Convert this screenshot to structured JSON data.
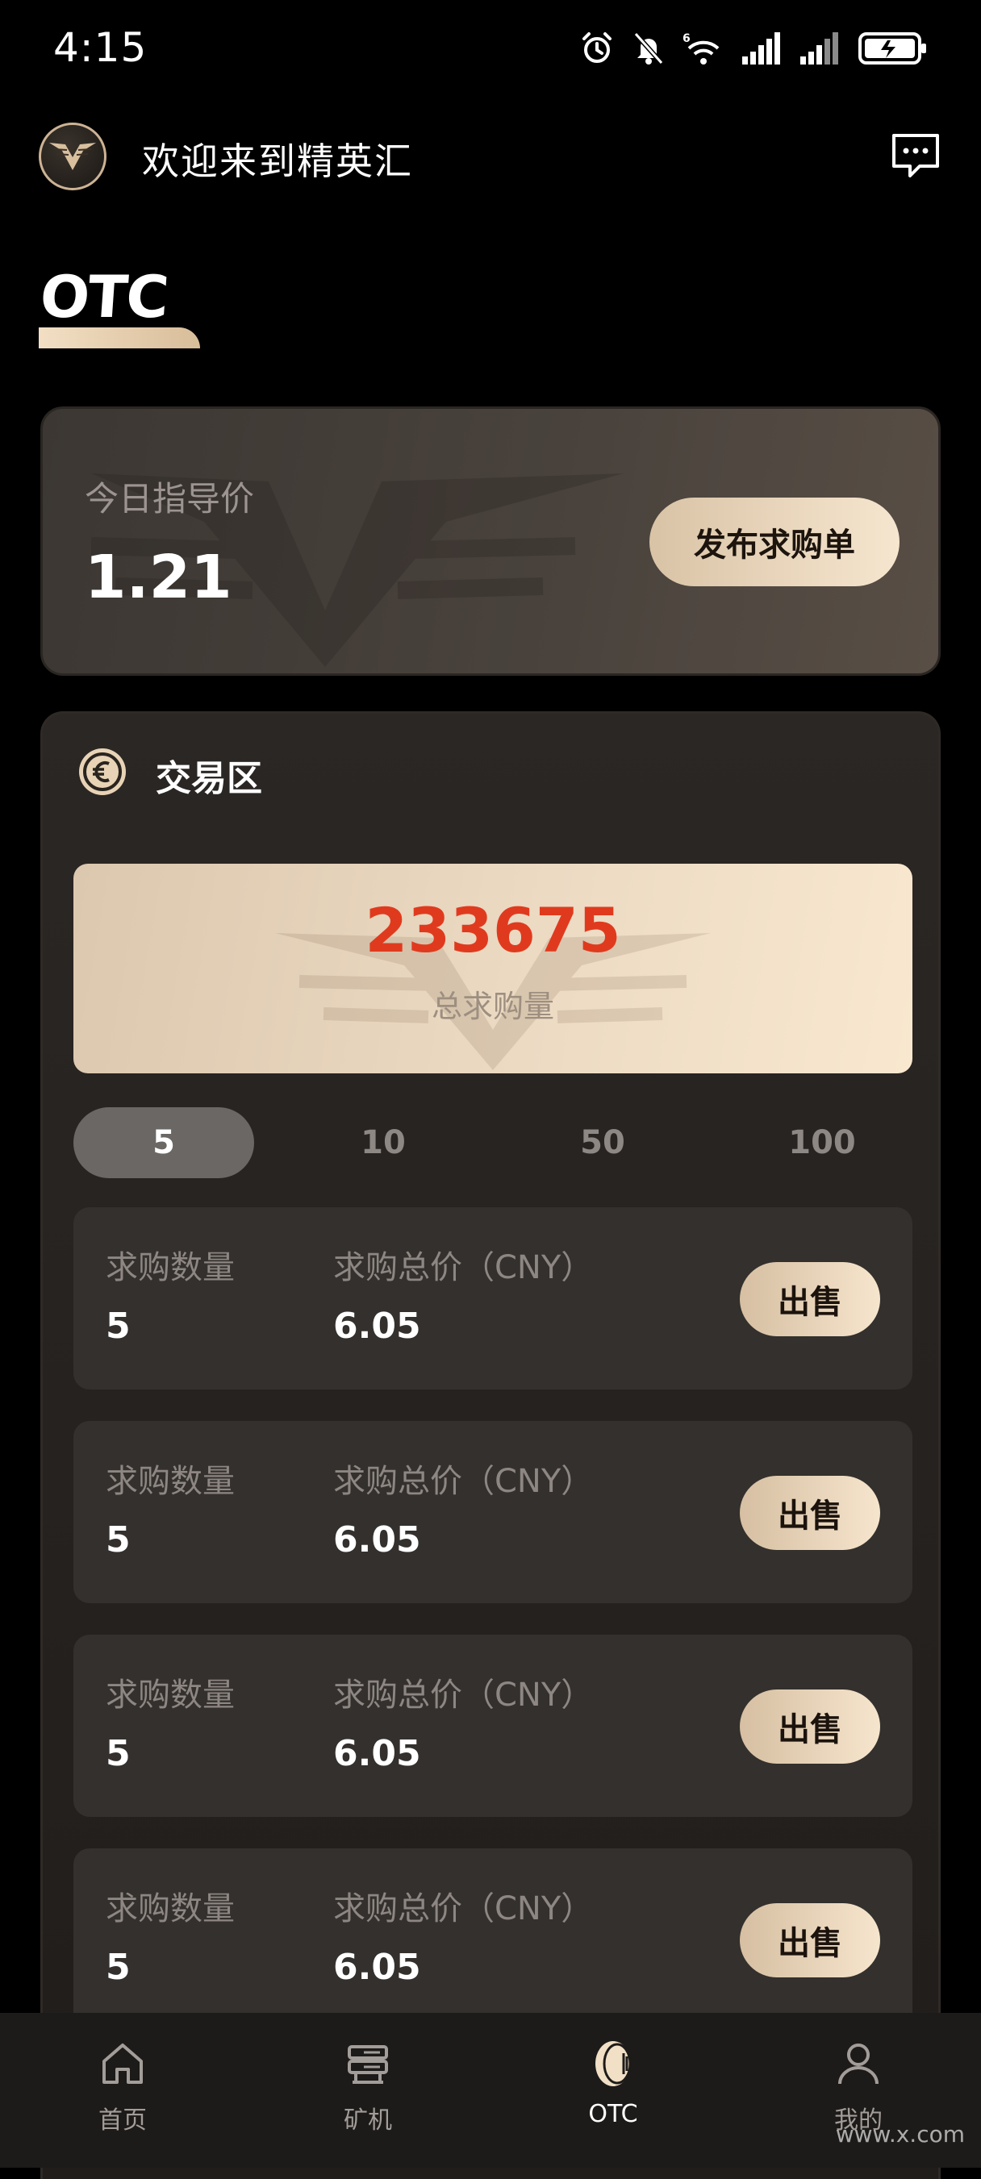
{
  "status_bar": {
    "time": "4:15",
    "icons": [
      "alarm-icon",
      "silent-bell-icon",
      "wifi-6-icon",
      "signal-icon",
      "signal-icon-2",
      "battery-charging-icon"
    ]
  },
  "header": {
    "welcome": "欢迎来到精英汇",
    "logo_icon": "eagle-logo-icon",
    "message_icon": "message-icon"
  },
  "page_title": "OTC",
  "guide_price": {
    "label": "今日指导价",
    "value": "1.21",
    "publish_button": "发布求购单"
  },
  "trade_zone": {
    "title": "交易区",
    "icon": "euro-coin-icon",
    "total_value": "233675",
    "total_label": "总求购量",
    "qty_tabs": [
      "5",
      "10",
      "50",
      "100"
    ],
    "active_tab": "5",
    "orders": [
      {
        "qty_label": "求购数量",
        "qty": "5",
        "total_label": "求购总价（CNY）",
        "total": "6.05",
        "sell": "出售"
      },
      {
        "qty_label": "求购数量",
        "qty": "5",
        "total_label": "求购总价（CNY）",
        "total": "6.05",
        "sell": "出售"
      },
      {
        "qty_label": "求购数量",
        "qty": "5",
        "total_label": "求购总价（CNY）",
        "total": "6.05",
        "sell": "出售"
      },
      {
        "qty_label": "求购数量",
        "qty": "5",
        "total_label": "求购总价（CNY）",
        "total": "6.05",
        "sell": "出售"
      }
    ]
  },
  "bottom_nav": {
    "items": [
      {
        "label": "首页",
        "icon": "home-icon"
      },
      {
        "label": "矿机",
        "icon": "miner-icon"
      },
      {
        "label": "OTC",
        "icon": "otc-coin-icon"
      },
      {
        "label": "我的",
        "icon": "user-icon"
      }
    ],
    "active": "OTC"
  },
  "overlay_watermark": "www.x.com"
}
